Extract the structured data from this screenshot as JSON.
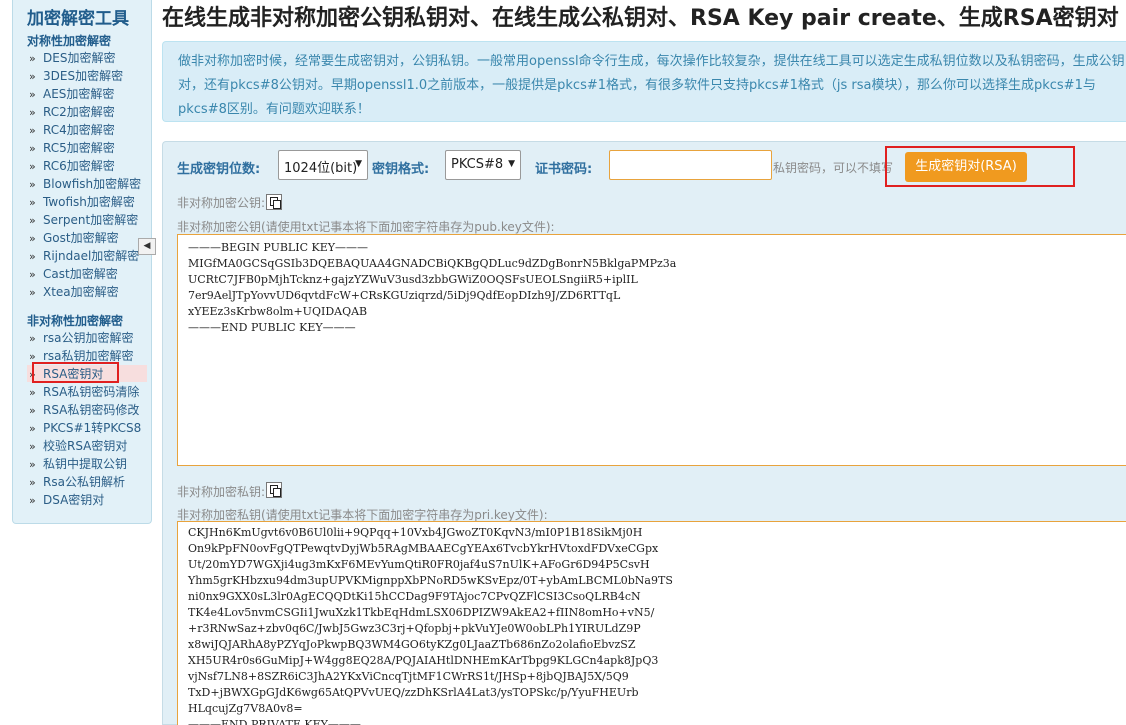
{
  "sidebar": {
    "title": "加密解密工具",
    "group1": "对称性加密解密",
    "items1": [
      "DES加密解密",
      "3DES加密解密",
      "AES加密解密",
      "RC2加密解密",
      "RC4加密解密",
      "RC5加密解密",
      "RC6加密解密",
      "Blowfish加密解密",
      "Twofish加密解密",
      "Serpent加密解密",
      "Gost加密解密",
      "Rijndael加密解密",
      "Cast加密解密",
      "Xtea加密解密"
    ],
    "group2": "非对称性加密解密",
    "items2": [
      "rsa公钥加密解密",
      "rsa私钥加密解密",
      "RSA密钥对",
      "RSA私钥密码清除",
      "RSA私钥密码修改",
      "PKCS#1转PKCS8",
      "校验RSA密钥对",
      "私钥中提取公钥",
      "Rsa公私钥解析",
      "DSA密钥对"
    ],
    "arrow": "»",
    "collapse_icon": "◀",
    "active_item": "RSA密钥对"
  },
  "page": {
    "heading": "在线生成非对称加密公钥私钥对、在线生成公私钥对、RSA Key pair create、生成RSA密钥对",
    "description": "做非对称加密时候，经常要生成密钥对，公钥私钥。一般常用openssl命令行生成，每次操作比较复杂，提供在线工具可以选定生成私钥位数以及私钥密码，生成公钥对，还有pkcs#8公钥对。早期openssl1.0之前版本，一般提供是pkcs#1格式，有很多软件只支持pkcs#1格式（js rsa模块），那么你可以选择生成pkcs#1与pkcs#8区别。有问题欢迎联系！"
  },
  "form": {
    "bits_label": "生成密钥位数:",
    "bits_value": "1024位(bit)",
    "format_label": "密钥格式:",
    "format_value": "PKCS#8",
    "password_label": "证书密码:",
    "password_hint": "私钥密码，可以不填写",
    "generate_button": "生成密钥对(RSA)",
    "caret": "▼"
  },
  "public_key": {
    "label": "非对称加密公钥:",
    "sublabel": "非对称加密公钥(请使用txt记事本将下面加密字符串存为pub.key文件):",
    "lines": [
      "———BEGIN PUBLIC KEY———",
      "MIGfMA0GCSqGSIb3DQEBAQUAA4GNADCBiQKBgQDLuc9dZDgBonrN5BklgaPMPz3a",
      "UCRtC7JFB0pMjhTcknz+gajzYZWuV3usd3zbbGWiZ0OQSFsUEOLSngiiR5+iplIL",
      "7er9AelJTpYovvUD6qvtdFcW+CRsKGUziqrzd/5iDj9QdfEopDIzh9J/ZD6RTTqL",
      "xYEEz3sKrbw8olm+UQIDAQAB",
      "———END PUBLIC KEY———"
    ]
  },
  "private_key": {
    "label": "非对称加密私钥:",
    "sublabel": "非对称加密私钥(请使用txt记事本将下面加密字符串存为pri.key文件):",
    "lines": [
      "CKJHn6KmUgvt6v0B6Ul0lii+9QPqq+10Vxb4JGwoZT0KqvN3/mI0P1B18SikMj0H",
      "On9kPpFN0ovFgQTPewqtvDyjWb5RAgMBAAECgYEAx6TvcbYkrHVtoxdFDVxeCGpx",
      "Ut/20mYD7WGXji4ug3mKxF6MEvYumQtiR0FR0jaf4uS7nUlK+AFoGr6D94P5CsvH",
      "Yhm5grKHbzxu94dm3upUPVKMignppXbPNoRD5wKSvEpz/0T+ybAmLBCML0bNa9TS",
      "ni0nx9GXX0sL3lr0AgECQQDtKi15hCCDag9F9TAjoc7CPvQZFlCSI3CsoQLRB4cN",
      "TK4e4Lov5nvmCSGIi1JwuXzk1TkbEqHdmLSX06DPIZW9AkEA2+fIIN8omHo+vN5/",
      "+r3RNwSaz+zbv0q6C/JwbJ5Gwz3C3rj+Qfopbj+pkVuYJe0W0obLPh1YIRULdZ9P",
      "x8wiJQJARhA8yPZYqJoPkwpBQ3WM4GO6tyKZg0LJaaZTb686nZo2olafioEbvzSZ",
      "XH5UR4r0s6GuMipJ+W4gg8EQ28A/PQJAIAHtlDNHEmKArTbpg9KLGCn4apk8JpQ3",
      "vjNsf7LN8+8SZR6iC3JhA2YKxViCncqTjtMF1CWrRS1t/JHSp+8jbQJBAJ5X/5Q9",
      "TxD+jBWXGpGJdK6wg65AtQPVvUEQ/zzDhKSrlA4Lat3/ysTOPSkc/p/YyuFHEUrb",
      "HLqcujZg7V8A0v8=",
      "———END PRIVATE KEY———"
    ]
  }
}
